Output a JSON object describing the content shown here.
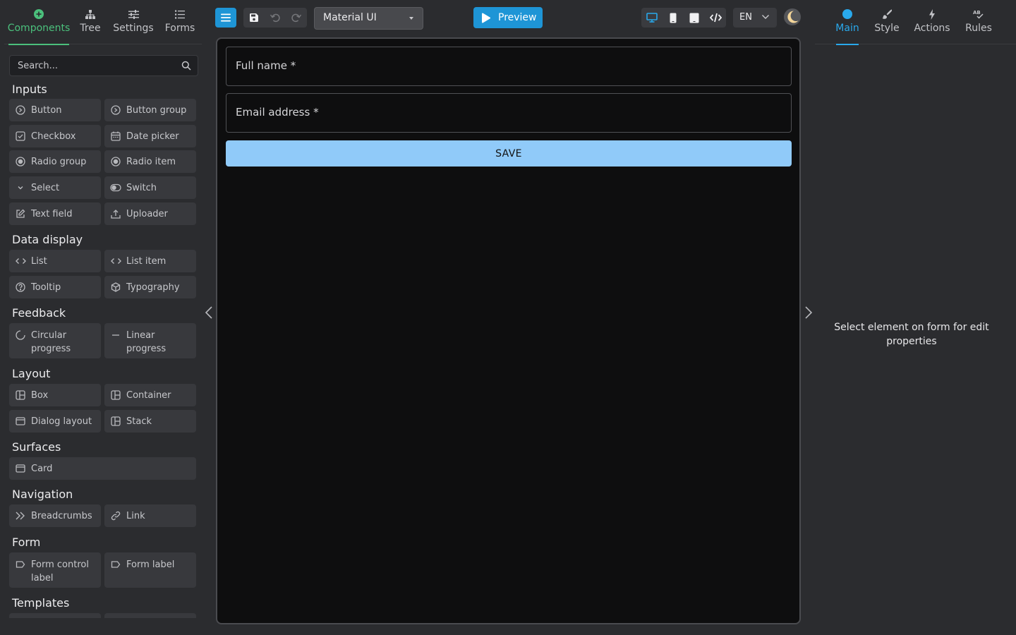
{
  "left_panel": {
    "tabs": [
      {
        "label": "Components",
        "icon": "plus-circle-icon",
        "active": true
      },
      {
        "label": "Tree",
        "icon": "sitemap-icon"
      },
      {
        "label": "Settings",
        "icon": "sliders-icon"
      },
      {
        "label": "Forms",
        "icon": "list-icon"
      }
    ],
    "search_placeholder": "Search...",
    "sections": {
      "inputs": {
        "title": "Inputs",
        "items": [
          "Button",
          "Button group",
          "Checkbox",
          "Date picker",
          "Radio group",
          "Radio item",
          "Select",
          "Switch",
          "Text field",
          "Uploader"
        ]
      },
      "data_display": {
        "title": "Data display",
        "items": [
          "List",
          "List item",
          "Tooltip",
          "Typography"
        ]
      },
      "feedback": {
        "title": "Feedback",
        "items": [
          "Circular progress",
          "Linear progress"
        ]
      },
      "layout": {
        "title": "Layout",
        "items": [
          "Box",
          "Container",
          "Dialog layout",
          "Stack"
        ]
      },
      "surfaces": {
        "title": "Surfaces",
        "items": [
          "Card"
        ]
      },
      "navigation": {
        "title": "Navigation",
        "items": [
          "Breadcrumbs",
          "Link"
        ]
      },
      "form": {
        "title": "Form",
        "items": [
          "Form control label",
          "Form label"
        ]
      },
      "templates": {
        "title": "Templates"
      }
    }
  },
  "toolbar": {
    "library": "Material UI",
    "preview_label": "Preview",
    "language": "EN",
    "buttons": [
      "menu-icon",
      "save-icon",
      "undo-icon",
      "redo-icon",
      "desktop-icon",
      "phone-icon",
      "tablet-icon",
      "code-icon",
      "moon-icon"
    ]
  },
  "canvas": {
    "fields": [
      {
        "label": "Full name *",
        "value": ""
      },
      {
        "label": "Email address *",
        "value": ""
      }
    ],
    "save_label": "SAVE"
  },
  "right_panel": {
    "tabs": [
      {
        "label": "Main",
        "icon": "circle-icon",
        "active": true
      },
      {
        "label": "Style",
        "icon": "brush-icon"
      },
      {
        "label": "Actions",
        "icon": "bolt-icon"
      },
      {
        "label": "Rules",
        "icon": "spellcheck-icon"
      }
    ],
    "hint": "Select element on form for edit properties"
  },
  "colors": {
    "accent_green": "#4bc07c",
    "accent_blue": "#1e95d6",
    "save_button": "#90caf9",
    "background": "#2b2c2f",
    "canvas": "#0e0e0f"
  }
}
